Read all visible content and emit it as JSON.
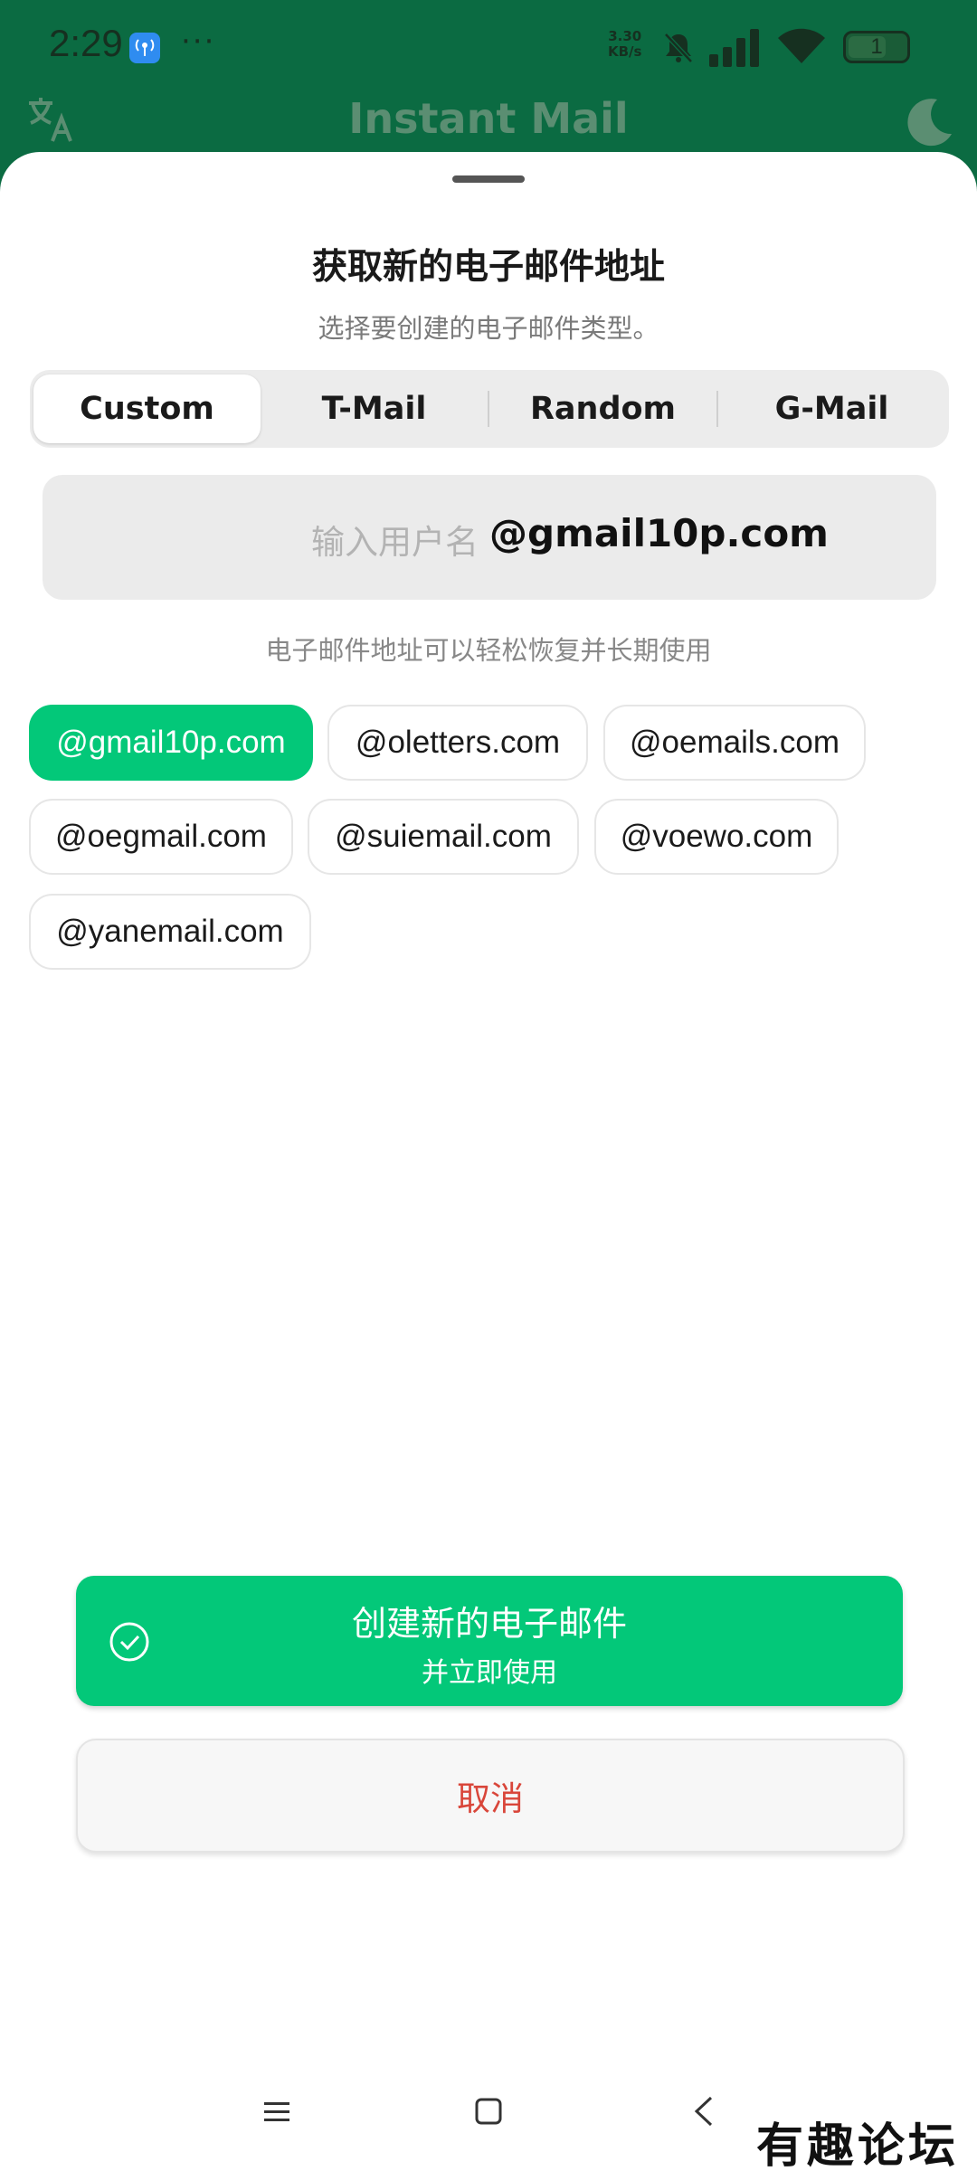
{
  "status_bar": {
    "time": "2:29",
    "overflow": "···",
    "net_speed_value": "3.30",
    "net_speed_unit": "KB/s",
    "battery": "1",
    "icons": [
      "hotspot-icon",
      "mute-bell-icon",
      "signal-icon",
      "wifi-icon",
      "battery-icon"
    ]
  },
  "app_bar": {
    "title": "Instant Mail",
    "left_icon": "translate-icon",
    "right_icon": "moon-icon"
  },
  "sheet": {
    "title": "获取新的电子邮件地址",
    "subtitle": "选择要创建的电子邮件类型。",
    "tabs": [
      {
        "label": "Custom",
        "active": true
      },
      {
        "label": "T-Mail",
        "active": false
      },
      {
        "label": "Random",
        "active": false
      },
      {
        "label": "G-Mail",
        "active": false
      }
    ],
    "username_input": {
      "placeholder": "输入用户名",
      "value": "",
      "domain": "@gmail10p.com"
    },
    "hint": "电子邮件地址可以轻松恢复并长期使用",
    "domains": [
      {
        "label": "@gmail10p.com",
        "selected": true
      },
      {
        "label": "@oletters.com",
        "selected": false
      },
      {
        "label": "@oemails.com",
        "selected": false
      },
      {
        "label": "@oegmail.com",
        "selected": false
      },
      {
        "label": "@suiemail.com",
        "selected": false
      },
      {
        "label": "@voewo.com",
        "selected": false
      },
      {
        "label": "@yanemail.com",
        "selected": false
      }
    ]
  },
  "actions": {
    "create_line1": "创建新的电子邮件",
    "create_line2": "并立即使用",
    "cancel": "取消"
  },
  "watermark": "有趣论坛",
  "colors": {
    "header_green": "#0b6b42",
    "accent_green": "#03c879",
    "cancel_red": "#d9463a"
  }
}
